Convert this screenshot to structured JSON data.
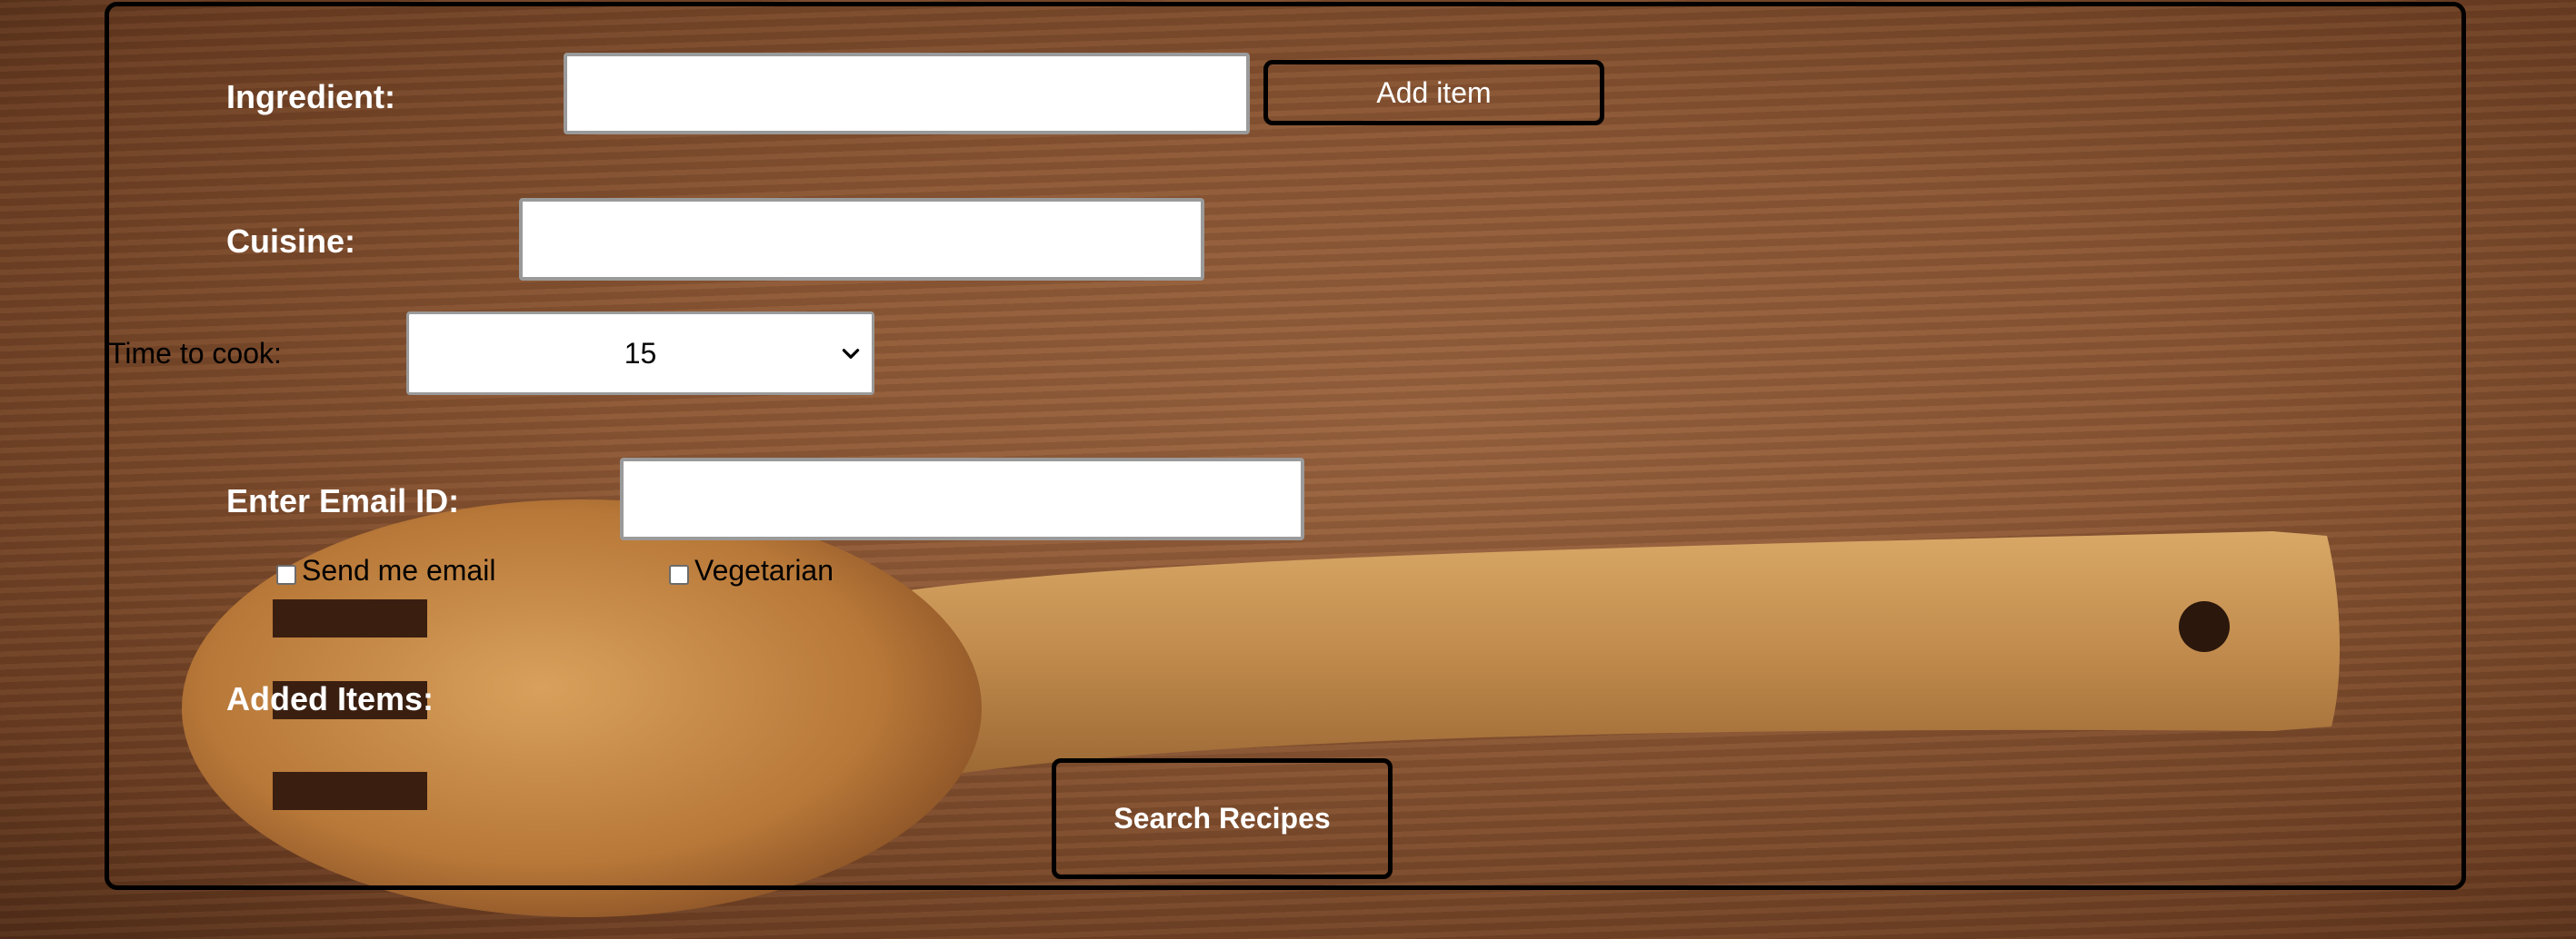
{
  "form": {
    "ingredient_label": "Ingredient:",
    "ingredient_value": "",
    "add_item_label": "Add item",
    "cuisine_label": "Cuisine:",
    "cuisine_value": "",
    "time_label": "Time to cook:",
    "time_selected": "15",
    "email_label": "Enter Email ID:",
    "email_value": "",
    "send_email_label": "Send me email",
    "send_email_checked": false,
    "vegetarian_label": "Vegetarian",
    "vegetarian_checked": false,
    "added_items_label": "Added Items:",
    "search_label": "Search Recipes"
  },
  "icons": {
    "select_arrow": "chevron-down-icon",
    "background": "wooden-spoon-on-wood-table"
  },
  "colors": {
    "label_text": "#ffffff",
    "border": "#000000",
    "input_border": "#9a9a9a",
    "wood_background": "#8a5634"
  }
}
